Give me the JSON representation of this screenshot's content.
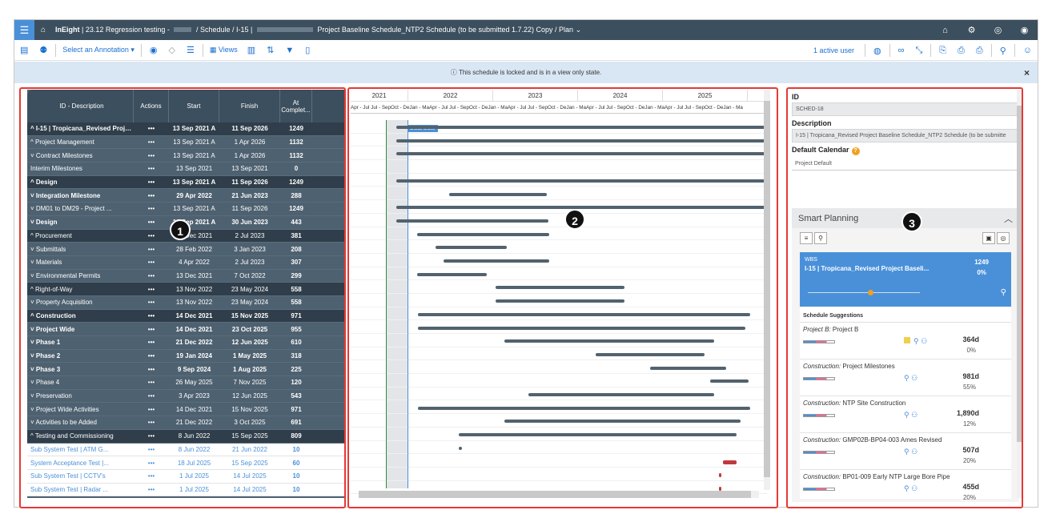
{
  "topbar": {
    "app": "InEight",
    "breadcrumb_prefix": "| 23.12 Regression testing -",
    "breadcrumb_mid": "/ Schedule / I-15 |",
    "breadcrumb_tail": "Project Baseline Schedule_NTP2 Schedule (to be submitted 1.7.22) Copy / Plan",
    "icons": [
      "bank-icon",
      "gear-icon",
      "settings-icon",
      "user-icon"
    ]
  },
  "toolbar": {
    "annotation": "Select an Annotation",
    "views": "Views",
    "active_user": "1 active user"
  },
  "banner": {
    "text": "This schedule is locked and is in a view only state."
  },
  "grid": {
    "headers": [
      "ID - Description",
      "Actions",
      "Start",
      "Finish",
      "At Complet..."
    ],
    "rows": [
      {
        "d": "^ I-15 | Tropicana_Revised Proje...",
        "a": "•••",
        "s": "13 Sep 2021 A",
        "f": "11 Sep 2026",
        "c": "1249",
        "style": "dark bold"
      },
      {
        "d": "^ Project Management",
        "a": "•••",
        "s": "13 Sep 2021 A",
        "f": "1 Apr 2026",
        "c": "1132",
        "style": "mid"
      },
      {
        "d": "   ˅ Contract Milestones",
        "a": "•••",
        "s": "13 Sep 2021 A",
        "f": "1 Apr 2026",
        "c": "1132",
        "style": "mid"
      },
      {
        "d": "      Interim Milestones",
        "a": "•••",
        "s": "13 Sep 2021",
        "f": "13 Sep 2021",
        "c": "0",
        "style": "mid"
      },
      {
        "d": "^ Design",
        "a": "•••",
        "s": "13 Sep 2021 A",
        "f": "11 Sep 2026",
        "c": "1249",
        "style": "dark bold"
      },
      {
        "d": "   ˅ Integration Milestone",
        "a": "•••",
        "s": "29 Apr 2022",
        "f": "21 Jun 2023",
        "c": "288",
        "style": "mid bold"
      },
      {
        "d": "   ˅ DM01 to DM29 - Project ...",
        "a": "•••",
        "s": "13 Sep 2021 A",
        "f": "11 Sep 2026",
        "c": "1249",
        "style": "mid"
      },
      {
        "d": "   ˅ Design",
        "a": "•••",
        "s": "13 Sep 2021 A",
        "f": "30 Jun 2023",
        "c": "443",
        "style": "mid bold"
      },
      {
        "d": "^ Procurement",
        "a": "•••",
        "s": "13 Dec 2021",
        "f": "2 Jul 2023",
        "c": "381",
        "style": "dark"
      },
      {
        "d": "   ˅ Submittals",
        "a": "•••",
        "s": "28 Feb 2022",
        "f": "3 Jan 2023",
        "c": "208",
        "style": "mid"
      },
      {
        "d": "   ˅ Materials",
        "a": "•••",
        "s": "4 Apr 2022",
        "f": "2 Jul 2023",
        "c": "307",
        "style": "mid"
      },
      {
        "d": "   ˅ Environmental Permits",
        "a": "•••",
        "s": "13 Dec 2021",
        "f": "7 Oct 2022",
        "c": "299",
        "style": "mid"
      },
      {
        "d": "^ Right-of-Way",
        "a": "•••",
        "s": "13 Nov 2022",
        "f": "23 May 2024",
        "c": "558",
        "style": "dark"
      },
      {
        "d": "   ˅ Property Acquisition",
        "a": "•••",
        "s": "13 Nov 2022",
        "f": "23 May 2024",
        "c": "558",
        "style": "mid"
      },
      {
        "d": "^ Construction",
        "a": "•••",
        "s": "14 Dec 2021",
        "f": "15 Nov 2025",
        "c": "971",
        "style": "dark bold"
      },
      {
        "d": "   ˅ Project Wide",
        "a": "•••",
        "s": "14 Dec 2021",
        "f": "23 Oct 2025",
        "c": "955",
        "style": "mid bold"
      },
      {
        "d": "   ˅ Phase 1",
        "a": "•••",
        "s": "21 Dec 2022",
        "f": "12 Jun 2025",
        "c": "610",
        "style": "mid bold"
      },
      {
        "d": "   ˅ Phase 2",
        "a": "•••",
        "s": "19 Jan 2024",
        "f": "1 May 2025",
        "c": "318",
        "style": "mid bold"
      },
      {
        "d": "   ˅ Phase 3",
        "a": "•••",
        "s": "9 Sep 2024",
        "f": "1 Aug 2025",
        "c": "225",
        "style": "mid bold"
      },
      {
        "d": "   ˅ Phase 4",
        "a": "•••",
        "s": "26 May 2025",
        "f": "7 Nov 2025",
        "c": "120",
        "style": "mid"
      },
      {
        "d": "   ˅ Preservation",
        "a": "•••",
        "s": "3 Apr 2023",
        "f": "12 Jun 2025",
        "c": "543",
        "style": "mid"
      },
      {
        "d": "   ˅ Project Wide Activities",
        "a": "•••",
        "s": "14 Dec 2021",
        "f": "15 Nov 2025",
        "c": "971",
        "style": "mid"
      },
      {
        "d": "   ˅ Activities to be Added",
        "a": "•••",
        "s": "21 Dec 2022",
        "f": "3 Oct 2025",
        "c": "691",
        "style": "mid"
      },
      {
        "d": "^ Testing and Commissioning",
        "a": "•••",
        "s": "8 Jun 2022",
        "f": "15 Sep 2025",
        "c": "809",
        "style": "dark"
      },
      {
        "d": "      Sub System Test | ATM G...",
        "a": "•••",
        "s": "8 Jun 2022",
        "f": "21 Jun 2022",
        "c": "10",
        "style": "light"
      },
      {
        "d": "      System Acceptance Test |...",
        "a": "•••",
        "s": "18 Jul 2025",
        "f": "15 Sep 2025",
        "c": "60",
        "style": "light"
      },
      {
        "d": "      Sub System Test | CCTV's",
        "a": "•••",
        "s": "1 Jul 2025",
        "f": "14 Jul 2025",
        "c": "10",
        "style": "light"
      },
      {
        "d": "      Sub System Test | Radar ...",
        "a": "•••",
        "s": "1 Jul 2025",
        "f": "14 Jul 2025",
        "c": "10",
        "style": "light"
      }
    ]
  },
  "gantt": {
    "years": [
      "2021",
      "2022",
      "2023",
      "2024",
      "2025"
    ],
    "months_text": "Apr - Jul Jul - SepOct - DeJan - MaApr - Jul Jul - SepOct - DeJan - MaApr - Jul Jul - SepOct - DeJan - MaApr - Jul Jul - SepOct - DeJan - MaApr - Jul Jul - SepOct - DeJan - Ma",
    "data_date_label": "Data Date",
    "bars": [
      {
        "row": 0,
        "from": "2021-09-13",
        "to": "2026-09-11"
      },
      {
        "row": 1,
        "from": "2021-09-13",
        "to": "2026-04-01"
      },
      {
        "row": 2,
        "from": "2021-09-13",
        "to": "2026-04-01"
      },
      {
        "row": 4,
        "from": "2021-09-13",
        "to": "2026-09-11"
      },
      {
        "row": 5,
        "from": "2022-04-29",
        "to": "2023-06-21"
      },
      {
        "row": 6,
        "from": "2021-09-13",
        "to": "2026-09-11"
      },
      {
        "row": 7,
        "from": "2021-09-13",
        "to": "2023-06-30"
      },
      {
        "row": 8,
        "from": "2021-12-13",
        "to": "2023-07-02"
      },
      {
        "row": 9,
        "from": "2022-02-28",
        "to": "2023-01-03"
      },
      {
        "row": 10,
        "from": "2022-04-04",
        "to": "2023-07-02"
      },
      {
        "row": 11,
        "from": "2021-12-13",
        "to": "2022-10-07"
      },
      {
        "row": 12,
        "from": "2022-11-13",
        "to": "2024-05-23"
      },
      {
        "row": 13,
        "from": "2022-11-13",
        "to": "2024-05-23"
      },
      {
        "row": 14,
        "from": "2021-12-14",
        "to": "2025-11-15"
      },
      {
        "row": 15,
        "from": "2021-12-14",
        "to": "2025-10-23"
      },
      {
        "row": 16,
        "from": "2022-12-21",
        "to": "2025-06-12"
      },
      {
        "row": 17,
        "from": "2024-01-19",
        "to": "2025-05-01"
      },
      {
        "row": 18,
        "from": "2024-09-09",
        "to": "2025-08-01"
      },
      {
        "row": 19,
        "from": "2025-05-26",
        "to": "2025-11-07"
      },
      {
        "row": 20,
        "from": "2023-04-03",
        "to": "2025-06-12"
      },
      {
        "row": 21,
        "from": "2021-12-14",
        "to": "2025-11-15"
      },
      {
        "row": 22,
        "from": "2022-12-21",
        "to": "2025-10-03"
      },
      {
        "row": 23,
        "from": "2022-06-08",
        "to": "2025-09-15"
      },
      {
        "row": 24,
        "from": "2022-06-08",
        "to": "2022-06-21"
      },
      {
        "row": 25,
        "from": "2025-07-18",
        "to": "2025-09-15",
        "red": true
      },
      {
        "row": 26,
        "from": "2025-07-01",
        "to": "2025-07-14",
        "red": true
      },
      {
        "row": 27,
        "from": "2025-07-01",
        "to": "2025-07-14",
        "red": true
      }
    ]
  },
  "panel": {
    "id_label": "ID",
    "id_value": "SCHED-18",
    "desc_label": "Description",
    "desc_value": "I-15 | Tropicana_Revised Project Baseline Schedule_NTP2 Schedule (to be submitte",
    "cal_label": "Default Calendar",
    "cal_value": "Project Default",
    "smart_planning": "Smart Planning",
    "wbs_tag": "WBS",
    "wbs_name": "I-15 | Tropicana_Revised Project Baseli...",
    "wbs_value": "1249",
    "wbs_pct": "0%",
    "suggestions_header": "Schedule Suggestions",
    "suggestions": [
      {
        "cat": "Project B:",
        "name": "Project B",
        "dur": "364d",
        "pct": "0%"
      },
      {
        "cat": "Construction:",
        "name": "Project Milestones",
        "dur": "981d",
        "pct": "55%"
      },
      {
        "cat": "Construction:",
        "name": "NTP Site Construction",
        "dur": "1,890d",
        "pct": "12%"
      },
      {
        "cat": "Construction:",
        "name": "GMP02B-BP04-003 Ames Revised",
        "dur": "507d",
        "pct": "20%"
      },
      {
        "cat": "Construction:",
        "name": "BP01-009 Early NTP Large Bore Pipe",
        "dur": "455d",
        "pct": "20%"
      }
    ]
  },
  "callouts": [
    "1",
    "2",
    "3"
  ],
  "colors": {
    "accent": "#4a90d9",
    "header": "#3c4f5e",
    "highlight": "#e53935"
  }
}
